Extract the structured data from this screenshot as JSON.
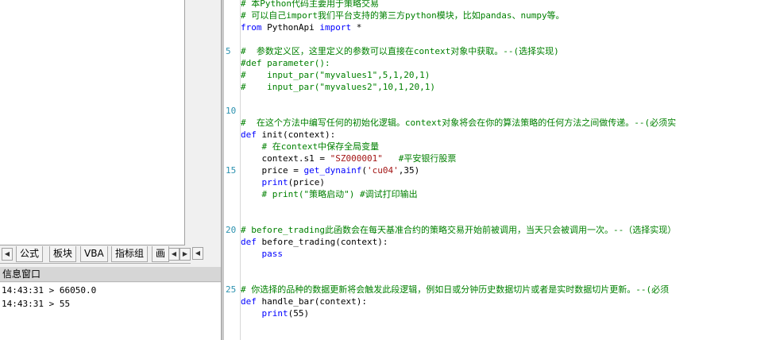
{
  "tabs": [
    "公式",
    "板块",
    "VBA",
    "指标组",
    "画"
  ],
  "info_panel": {
    "title": "信息窗口",
    "logs": [
      "14:43:31 > 66050.0",
      "14:43:31 > 55"
    ]
  },
  "line_numbers": [
    "5",
    "10",
    "15",
    "20",
    "25"
  ],
  "code": {
    "l1": "# 本Python代码主要用于策略交易",
    "l2": "# 可以自己import我们平台支持的第三方python模块，比如pandas、numpy等。",
    "l3_kw": "from",
    "l3_mid": " PythonApi ",
    "l3_kw2": "import",
    "l3_end": " *",
    "l5": "#  参数定义区，这里定义的参数可以直接在context对象中获取。--(选择实现)",
    "l6": "#def parameter():",
    "l7": "#    input_par(\"myvalues1\",5,1,20,1)",
    "l8": "#    input_par(\"myvalues2\",10,1,20,1)",
    "l11": "#  在这个方法中编写任何的初始化逻辑。context对象将会在你的算法策略的任何方法之间做传递。--(必须实",
    "l12_kw": "def",
    "l12_rest": " init(context):",
    "l13": "    # 在context中保存全局变量",
    "l14_a": "    context.s1 = ",
    "l14_str": "\"SZ000001\"",
    "l14_cmt": "   #平安银行股票",
    "l15_a": "    price = ",
    "l15_fn": "get_dynainf",
    "l15_b": "(",
    "l15_str": "'cu04'",
    "l15_c": ",35)",
    "l16_kw": "    print",
    "l16_rest": "(price)",
    "l17": "    # print(\"策略启动\") #调试打印输出",
    "l20": "# before_trading此函数会在每天基准合约的策略交易开始前被调用，当天只会被调用一次。--（选择实现）",
    "l21_kw": "def",
    "l21_rest": " before_trading(context):",
    "l22": "    pass",
    "l25": "# 你选择的品种的数据更新将会触发此段逻辑，例如日或分钟历史数据切片或者是实时数据切片更新。--(必须",
    "l26_kw": "def",
    "l26_rest": " handle_bar(context):",
    "l27_kw": "    print",
    "l27_rest": "(55)"
  }
}
